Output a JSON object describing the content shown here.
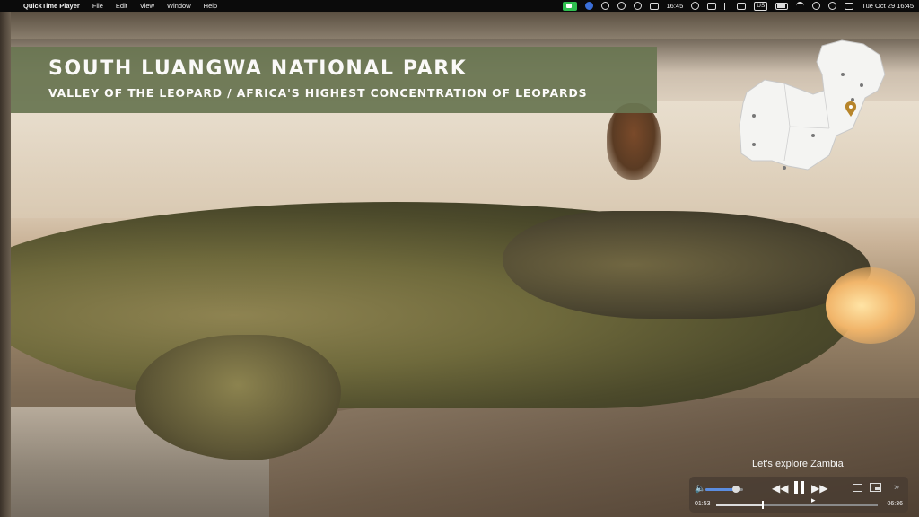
{
  "menubar": {
    "apple_symbol": "",
    "app_name": "QuickTime Player",
    "menus": [
      "File",
      "Edit",
      "View",
      "Window",
      "Help"
    ],
    "clock": "16:45",
    "input_source": "US",
    "date_time": "Tue Oct 29  16:45",
    "status_icons": [
      "facetime-camera-icon",
      "blue-circle-icon",
      "media-icon",
      "speed-icon",
      "record-icon",
      "monitor-icon",
      "cloud-icon",
      "copy-icon",
      "bluetooth-icon",
      "input-source-icon",
      "battery-icon",
      "wifi-icon",
      "search-icon",
      "user-icon",
      "control-center-icon"
    ]
  },
  "overlay": {
    "title": "SOUTH LUANGWA NATIONAL PARK",
    "subtitle": "VALLEY OF THE LEOPARD / AFRICA'S HIGHEST CONCENTRATION OF LEOPARDS",
    "banner_color": "#6a7652",
    "caption": "Let's explore Zambia"
  },
  "player": {
    "current_time": "01:53",
    "total_time": "06:36",
    "progress": 0.285,
    "volume": 0.8,
    "state": "playing",
    "accent_color": "#5b8de0"
  }
}
